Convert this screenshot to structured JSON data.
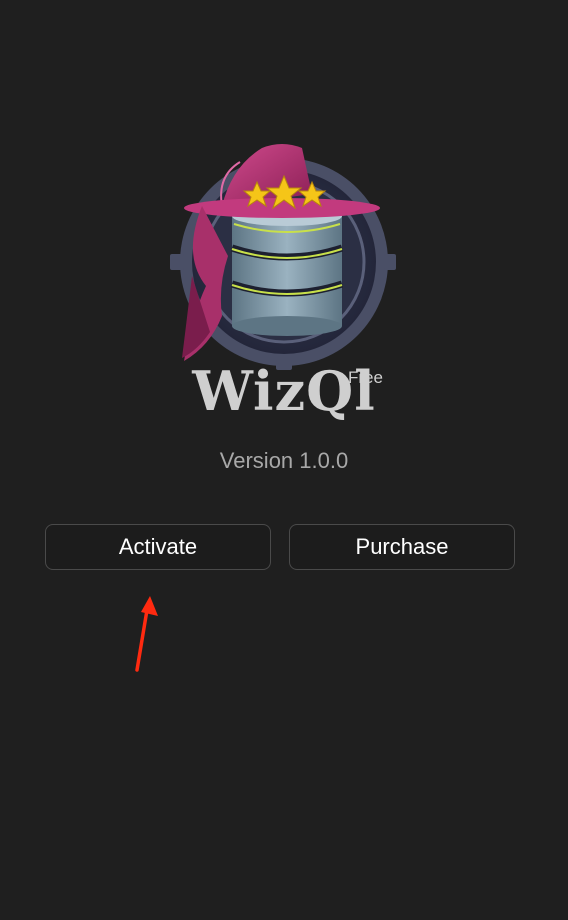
{
  "app": {
    "name": "WizQl",
    "edition": "Free",
    "version": "Version 1.0.0",
    "logo_icon": "wizard-hat-database-icon"
  },
  "actions": {
    "activate_label": "Activate",
    "purchase_label": "Purchase"
  },
  "colors": {
    "background": "#1f1f1f",
    "hat": "#b0306e",
    "stars": "#f5c518",
    "database": "#7f9aaa",
    "accent_line": "#c8e04a",
    "annotation_arrow": "#ff2a10"
  }
}
